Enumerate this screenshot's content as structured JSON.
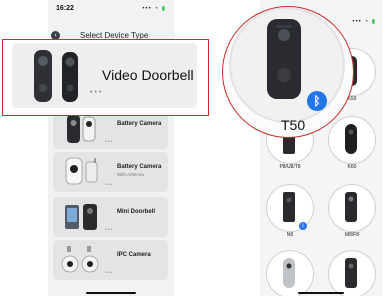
{
  "left_screen": {
    "status": {
      "time": "16:22",
      "signal": "•••",
      "wifi": "◔",
      "battery": "▮"
    },
    "header": {
      "title": "Select Device Type"
    },
    "callout": {
      "title": "Video Doorbell",
      "more": "•••"
    },
    "cards": [
      {
        "label": "Battery Camera",
        "sublabel": "",
        "more": "•••"
      },
      {
        "label": "Battery Camera",
        "sublabel": "With Antenna",
        "more": "•••"
      },
      {
        "label": "Mini Doorbell",
        "sublabel": "",
        "more": "•••"
      },
      {
        "label": "IPC Camera",
        "sublabel": "",
        "more": "•••"
      }
    ]
  },
  "right_screen": {
    "status": {
      "signal": "•••",
      "wifi": "◔",
      "battery": "▮"
    },
    "callout": {
      "model": "T50",
      "badge_icon": "bluetooth-icon"
    },
    "models": [
      {
        "label": "K50"
      },
      {
        "label": "P8/U8/T8"
      },
      {
        "label": "K60"
      },
      {
        "label": "N8",
        "badge": "bluetooth-icon"
      },
      {
        "label": "M8/F8"
      },
      {
        "label": ""
      },
      {
        "label": ""
      }
    ]
  },
  "colors": {
    "accent_red": "#cf2b2b",
    "bluetooth_blue": "#2276e8",
    "battery_green": "#2fbf4a"
  }
}
